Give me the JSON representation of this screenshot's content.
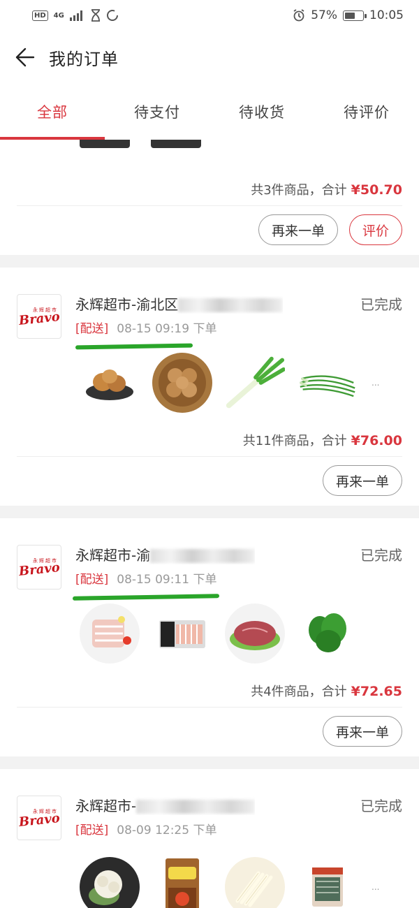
{
  "status_bar": {
    "network": "HD",
    "signal": "4G",
    "battery": "57%",
    "battery_level": 0.57,
    "time": "10:05"
  },
  "header": {
    "title": "我的订单",
    "back_icon": "arrow-left-icon"
  },
  "tabs": [
    {
      "label": "全部",
      "active": true
    },
    {
      "label": "待支付",
      "active": false
    },
    {
      "label": "待收货",
      "active": false
    },
    {
      "label": "待评价",
      "active": false
    }
  ],
  "orders": [
    {
      "summary": "共3件商品，合计",
      "total": "¥50.70",
      "actions": [
        "再来一单",
        "评价"
      ]
    },
    {
      "store": "永辉超市-渝北区",
      "status": "已完成",
      "tag": "[配送]",
      "time": "08-15 09:19 下单",
      "logo_small": "永辉超市",
      "logo_brand": "Bravo",
      "products": [
        "potatoes-pan",
        "potatoes-basket",
        "green-onion",
        "chives"
      ],
      "more": "...",
      "summary": "共11件商品，合计",
      "total": "¥76.00",
      "actions": [
        "再来一单"
      ]
    },
    {
      "store": "永辉超市-渝",
      "status": "已完成",
      "tag": "[配送]",
      "time": "08-15 09:11 下单",
      "logo_small": "永辉超市",
      "logo_brand": "Bravo",
      "products": [
        "pork-belly",
        "packaged-pork",
        "beef",
        "spinach"
      ],
      "summary": "共4件商品，合计",
      "total": "¥72.65",
      "actions": [
        "再来一单"
      ]
    },
    {
      "store": "永辉超市-",
      "status": "已完成",
      "tag": "[配送]",
      "time": "08-09 12:25 下单",
      "logo_small": "永辉超市",
      "logo_brand": "Bravo",
      "products": [
        "cauliflower",
        "packaged-snack",
        "enoki-mushroom",
        "packaged-noodles"
      ],
      "more": "..."
    }
  ]
}
